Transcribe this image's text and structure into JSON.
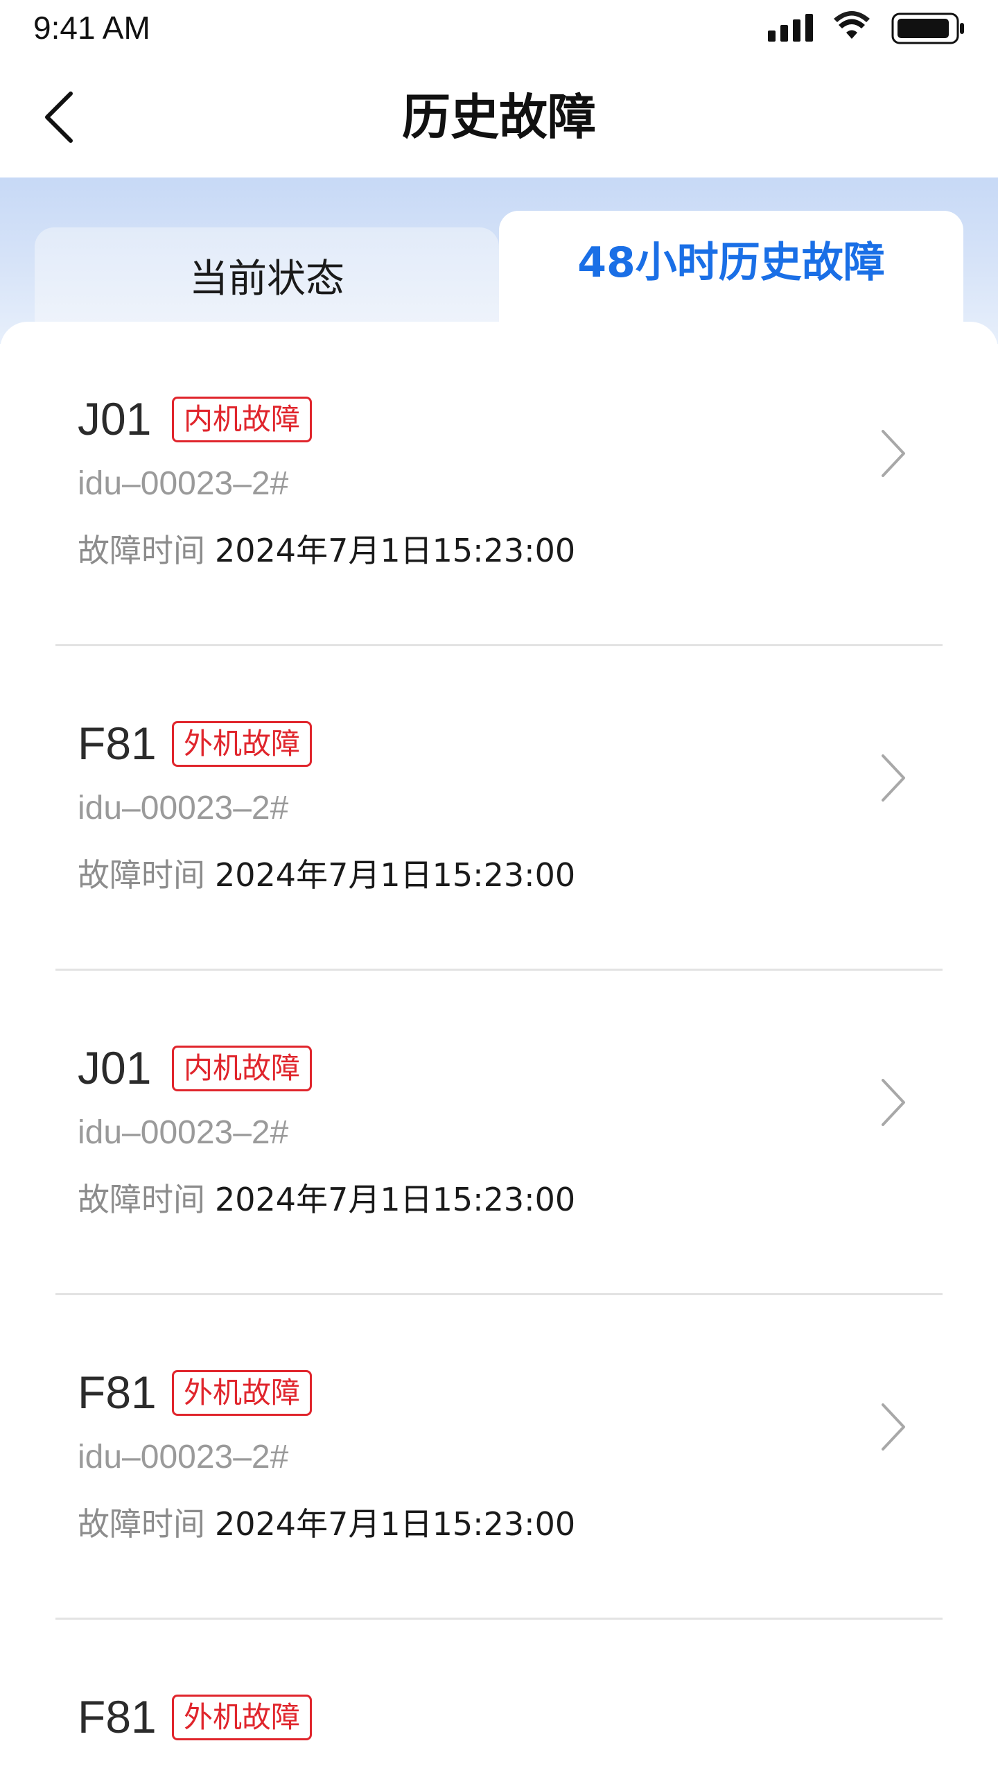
{
  "status_bar": {
    "time": "9:41 AM",
    "icons": [
      "signal-icon",
      "wifi-icon",
      "battery-icon"
    ]
  },
  "header": {
    "back_icon": "chevron-left-icon",
    "title": "历史故障"
  },
  "tabs": [
    {
      "label": "当前状态",
      "active": false
    },
    {
      "label": "48小时历史故障",
      "active": true
    }
  ],
  "colors": {
    "accent": "#1a6fe6",
    "tag_red": "#e0252c",
    "tab_bg": "#c7d9f6"
  },
  "faults": [
    {
      "code": "J01",
      "tag": "内机故障",
      "device": "idu–00023–2#",
      "time_label": "故障时间",
      "time": "2024年7月1日15:23:00"
    },
    {
      "code": "F81",
      "tag": "外机故障",
      "device": "idu–00023–2#",
      "time_label": "故障时间",
      "time": "2024年7月1日15:23:00"
    },
    {
      "code": "J01",
      "tag": "内机故障",
      "device": "idu–00023–2#",
      "time_label": "故障时间",
      "time": "2024年7月1日15:23:00"
    },
    {
      "code": "F81",
      "tag": "外机故障",
      "device": "idu–00023–2#",
      "time_label": "故障时间",
      "time": "2024年7月1日15:23:00"
    },
    {
      "code": "F81",
      "tag": "外机故障"
    }
  ]
}
